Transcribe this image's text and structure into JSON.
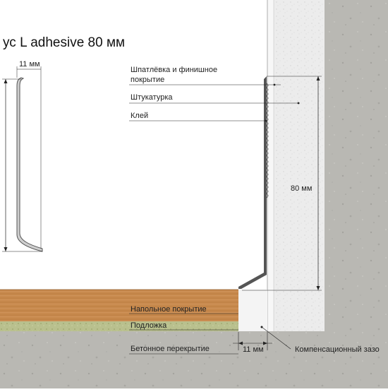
{
  "title": "ус L adhesive 80 мм",
  "dims": {
    "left_width": "11 мм",
    "height": "80 мм",
    "gap_width": "11 мм"
  },
  "labels": {
    "putty_line1": "Шпатлёвка и финишное",
    "putty_line2": "покрытие",
    "plaster": "Штукатурка",
    "glue": "Клей",
    "floor_covering": "Напольное покрытие",
    "underlay": "Подложка",
    "concrete_slab": "Бетонное перекрытие",
    "compensation_gap": "Компенсационный зазо"
  },
  "colors": {
    "concrete": "#b9b8b3",
    "plaster": "#eeeeee",
    "wood": "#c98a4e",
    "underlay": "#b9c08e",
    "profile": "#555555"
  }
}
